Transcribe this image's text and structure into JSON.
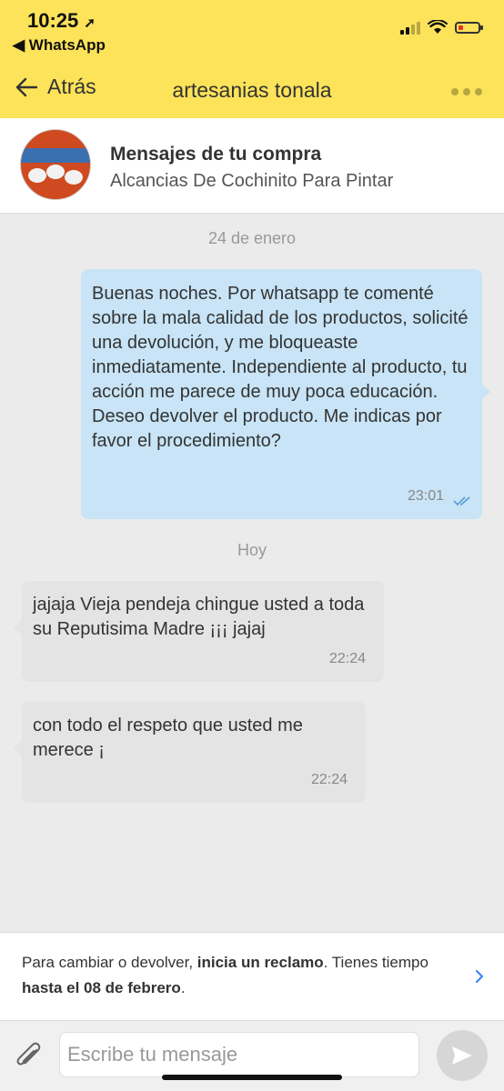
{
  "status_bar": {
    "time": "10:25",
    "back_app": "◀ WhatsApp"
  },
  "nav": {
    "back_label": "Atrás",
    "title": "artesanias tonala"
  },
  "product": {
    "title": "Mensajes de tu compra",
    "subtitle": "Alcancias De Cochinito Para Pintar"
  },
  "messages": [
    {
      "date": "24 de enero",
      "direction": "sent",
      "text": "Buenas noches. Por whatsapp te comenté sobre la mala calidad de los productos, solicité una devolución, y me bloqueaste inmediatamente. Independiente al producto, tu acción me parece de muy poca educación. Deseo devolver el producto. Me indicas por favor el procedimiento?",
      "time": "23:01"
    },
    {
      "date": "Hoy",
      "direction": "received",
      "text": "jajaja Vieja pendeja chingue usted a toda su Reputisima Madre ¡¡¡ jajaj",
      "time": "22:24"
    },
    {
      "direction": "received",
      "text": "con todo el respeto que usted me merece ¡",
      "time": "22:24"
    }
  ],
  "footer": {
    "text_1": "Para cambiar o devolver, ",
    "link": "inicia un reclamo",
    "text_2": ". Tienes tiempo ",
    "deadline": "hasta el 08 de febrero",
    "text_3": "."
  },
  "composer": {
    "placeholder": "Escribe tu mensaje"
  },
  "colors": {
    "header": "#fce35a",
    "sent_bubble": "#c8e4f6",
    "received_bubble": "#e4e4e4",
    "accent": "#3483fa"
  }
}
